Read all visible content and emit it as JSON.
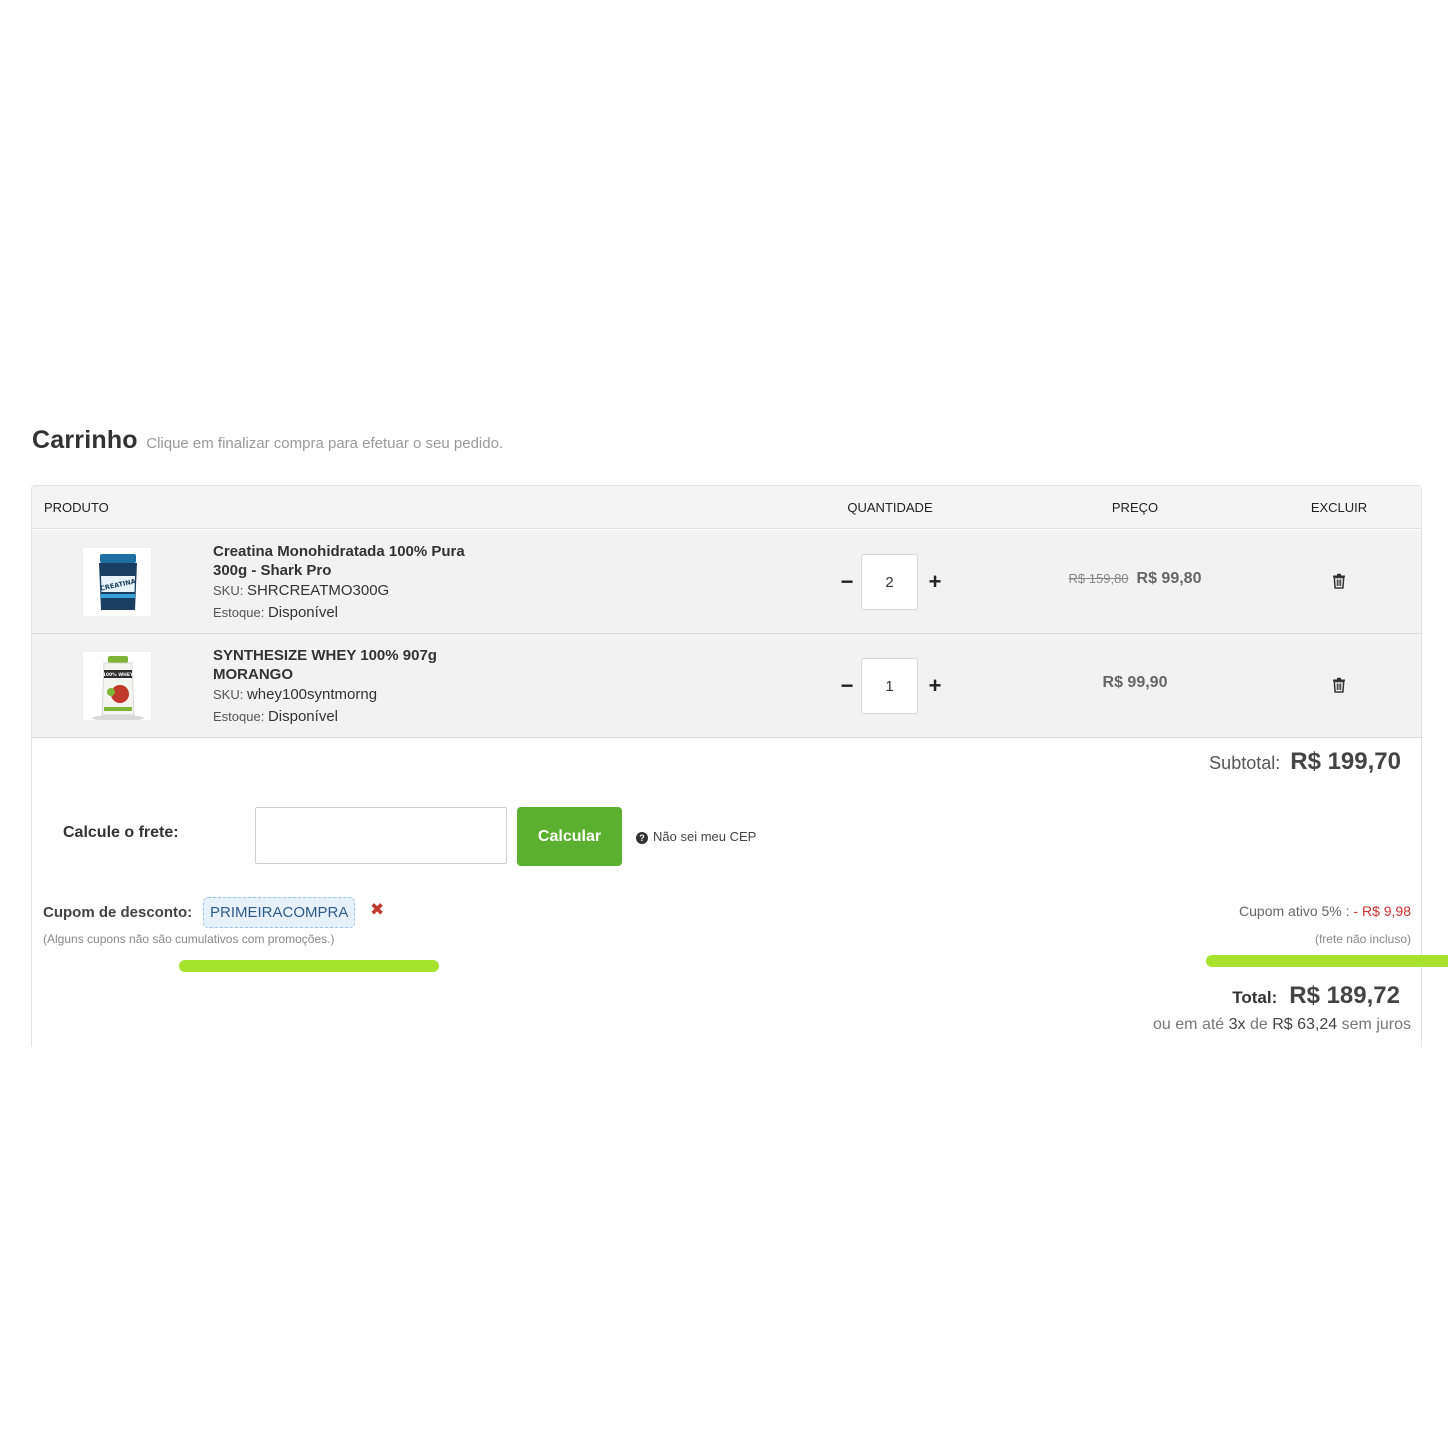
{
  "header": {
    "title": "Carrinho",
    "subtitle": "Clique em finalizar compra para efetuar o seu pedido."
  },
  "table": {
    "headers": {
      "product": "PRODUTO",
      "quantity": "QUANTIDADE",
      "price": "PREÇO",
      "delete": "EXCLUIR"
    },
    "rows": [
      {
        "name_line1": "Creatina Monohidratada 100% Pura",
        "name_line2": "300g - Shark Pro",
        "sku_label": "SKU:",
        "sku": "SHRCREATMO300G",
        "stock_label": "Estoque:",
        "stock": "Disponível",
        "quantity": "2",
        "old_price": "R$ 159,80",
        "price": "R$ 99,80",
        "image_label": "CREATINA"
      },
      {
        "name_line1": "SYNTHESIZE WHEY 100% 907g",
        "name_line2": "MORANGO",
        "sku_label": "SKU:",
        "sku": "whey100syntmorng",
        "stock_label": "Estoque:",
        "stock": "Disponível",
        "quantity": "1",
        "old_price": "",
        "price": "R$ 99,90",
        "image_label": "100% WHEY"
      }
    ],
    "minus_symbol": "−",
    "plus_symbol": "+",
    "delete_icon": "trash-icon"
  },
  "subtotal": {
    "label": "Subtotal:",
    "value": "R$ 199,70"
  },
  "shipping": {
    "label": "Calcule o frete:",
    "input_value": "",
    "button_label": "Calcular",
    "help_icon": "question-circle-icon",
    "help_link": "Não sei meu CEP"
  },
  "coupon": {
    "label": "Cupom de desconto:",
    "code": "PRIMEIRACOMPRA",
    "remove_icon": "close-icon",
    "note": "(Alguns cupons não são cumulativos com promoções.)",
    "active_label": "Cupom ativo 5% : ",
    "active_discount": "- R$ 9,98",
    "shipping_note": "(frete não incluso)"
  },
  "total": {
    "label": "Total:",
    "value": "R$ 189,72",
    "installment_prefix": "ou em até",
    "installment_count": "3x",
    "installment_de": "de",
    "installment_value": "R$ 63,24",
    "installment_suffix": "sem juros"
  },
  "colors": {
    "accent_green": "#5bb030",
    "highlight_green": "#a6e22e",
    "discount_red": "#d0312d",
    "coupon_blue": "#2d5d8c"
  }
}
